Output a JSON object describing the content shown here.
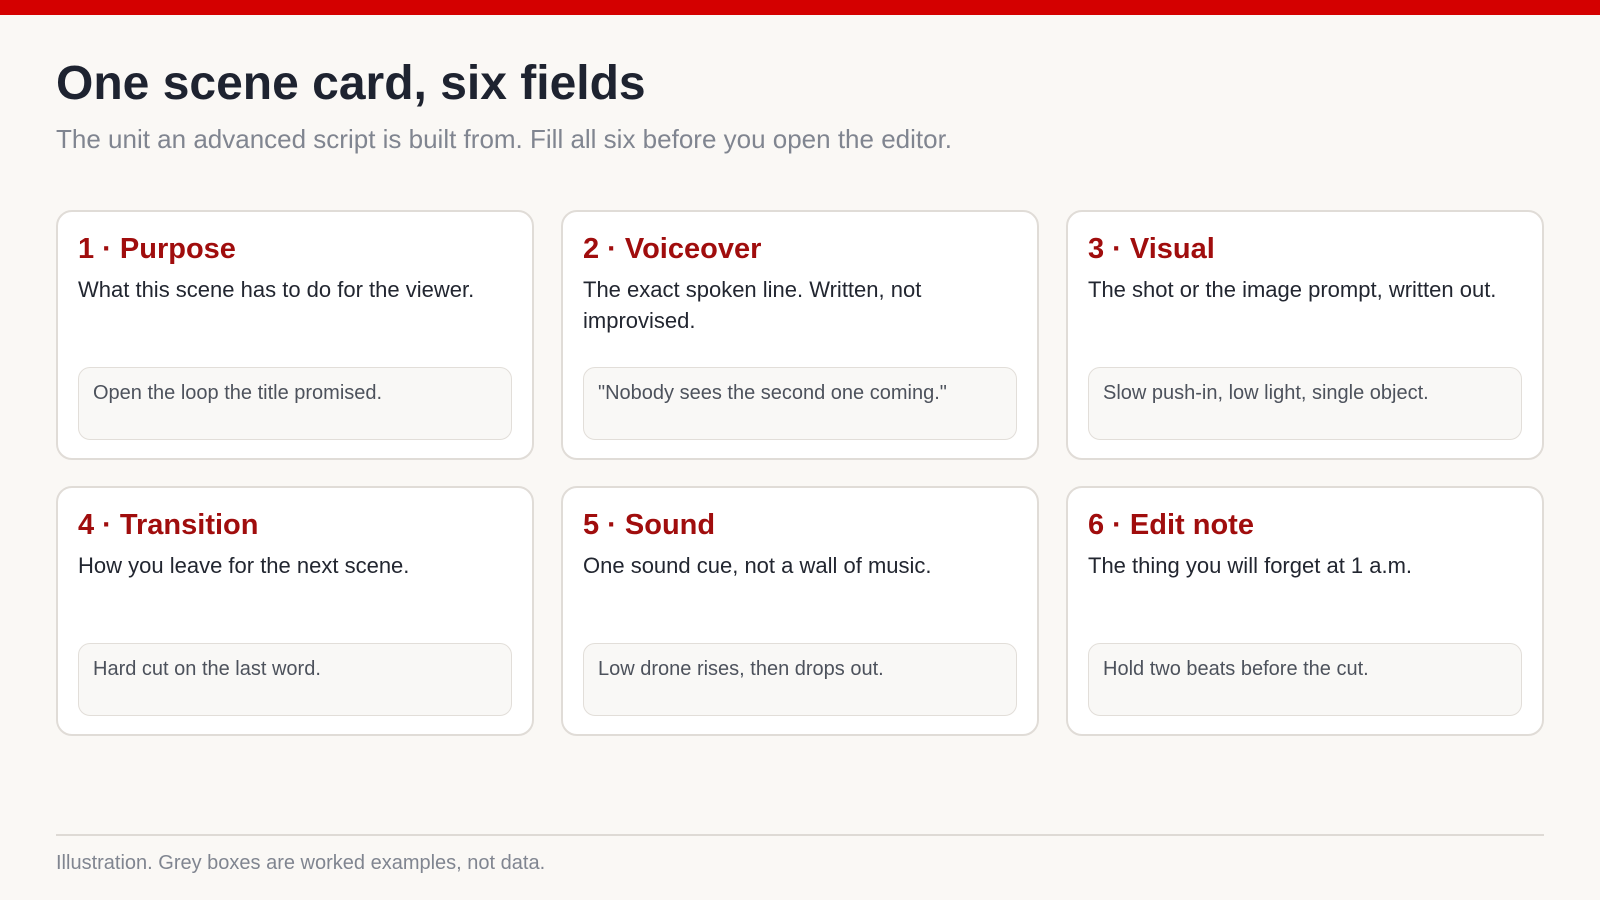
{
  "header": {
    "title": "One scene card, six fields",
    "subtitle": "The unit an advanced script is built from. Fill all six before you open the editor."
  },
  "cards": [
    {
      "heading": "1 · Purpose",
      "description": "What this scene has to do for the viewer.",
      "example": "Open the loop the title promised."
    },
    {
      "heading": "2 · Voiceover",
      "description": "The exact spoken line. Written, not improvised.",
      "example": "\"Nobody sees the second one coming.\""
    },
    {
      "heading": "3 · Visual",
      "description": "The shot or the image prompt, written out.",
      "example": "Slow push-in, low light, single object."
    },
    {
      "heading": "4 · Transition",
      "description": "How you leave for the next scene.",
      "example": "Hard cut on the last word."
    },
    {
      "heading": "5 · Sound",
      "description": "One sound cue, not a wall of music.",
      "example": "Low drone rises, then drops out."
    },
    {
      "heading": "6 · Edit note",
      "description": "The thing you will forget at 1 a.m.",
      "example": "Hold two beats before the cut."
    }
  ],
  "footer": {
    "note": "Illustration. Grey boxes are worked examples, not data."
  },
  "colors": {
    "accent_bar": "#d40000",
    "heading_red": "#a00d0d",
    "background": "#faf8f5"
  }
}
